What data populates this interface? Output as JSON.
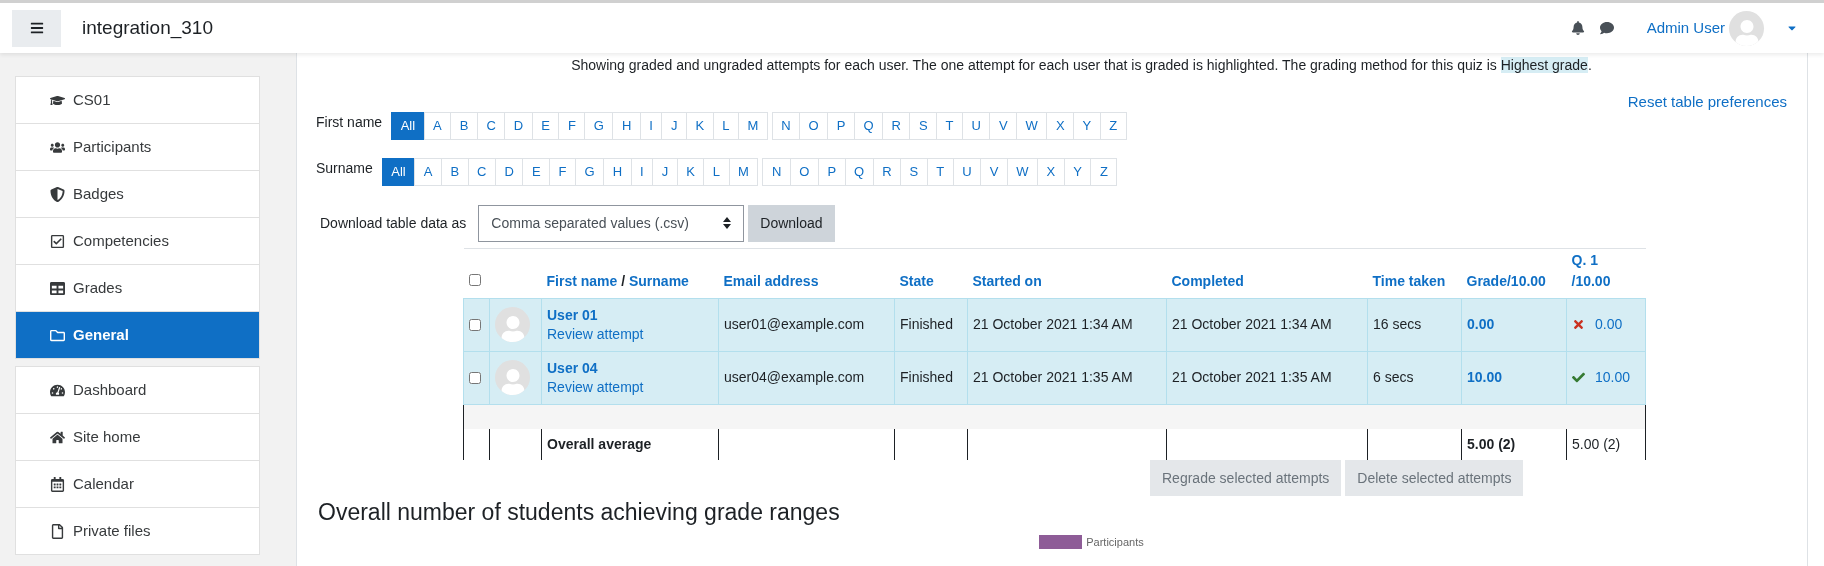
{
  "navbar": {
    "site_name": "integration_310",
    "user_name": "Admin User"
  },
  "sidebar": {
    "course_items": [
      {
        "label": "CS01",
        "selected": false
      },
      {
        "label": "Participants",
        "selected": false
      },
      {
        "label": "Badges",
        "selected": false
      },
      {
        "label": "Competencies",
        "selected": false
      },
      {
        "label": "Grades",
        "selected": false
      },
      {
        "label": "General",
        "selected": true
      }
    ],
    "site_items": [
      {
        "label": "Dashboard",
        "selected": false
      },
      {
        "label": "Site home",
        "selected": false
      },
      {
        "label": "Calendar",
        "selected": false
      },
      {
        "label": "Private files",
        "selected": false
      }
    ]
  },
  "intro": {
    "before": "Showing graded and ungraded attempts for each user. The one attempt for each user that is graded is highlighted. The grading method for this quiz is",
    "highlight": "Highest grade",
    "after": "."
  },
  "reset_link": "Reset table preferences",
  "filters": [
    {
      "label": "First name",
      "letters": [
        {
          "label": "All",
          "selected": true
        },
        {
          "label": "A",
          "selected": false
        },
        {
          "label": "B",
          "selected": false
        },
        {
          "label": "C",
          "selected": false
        },
        {
          "label": "D",
          "selected": false
        },
        {
          "label": "E",
          "selected": false
        },
        {
          "label": "F",
          "selected": false
        },
        {
          "label": "G",
          "selected": false
        },
        {
          "label": "H",
          "selected": false
        },
        {
          "label": "I",
          "selected": false
        },
        {
          "label": "J",
          "selected": false
        },
        {
          "label": "K",
          "selected": false
        },
        {
          "label": "L",
          "selected": false
        },
        {
          "label": "M",
          "selected": false
        },
        {
          "label": "N",
          "selected": false
        },
        {
          "label": "O",
          "selected": false
        },
        {
          "label": "P",
          "selected": false
        },
        {
          "label": "Q",
          "selected": false
        },
        {
          "label": "R",
          "selected": false
        },
        {
          "label": "S",
          "selected": false
        },
        {
          "label": "T",
          "selected": false
        },
        {
          "label": "U",
          "selected": false
        },
        {
          "label": "V",
          "selected": false
        },
        {
          "label": "W",
          "selected": false
        },
        {
          "label": "X",
          "selected": false
        },
        {
          "label": "Y",
          "selected": false
        },
        {
          "label": "Z",
          "selected": false
        }
      ]
    },
    {
      "label": "Surname",
      "letters": [
        {
          "label": "All",
          "selected": true
        },
        {
          "label": "A",
          "selected": false
        },
        {
          "label": "B",
          "selected": false
        },
        {
          "label": "C",
          "selected": false
        },
        {
          "label": "D",
          "selected": false
        },
        {
          "label": "E",
          "selected": false
        },
        {
          "label": "F",
          "selected": false
        },
        {
          "label": "G",
          "selected": false
        },
        {
          "label": "H",
          "selected": false
        },
        {
          "label": "I",
          "selected": false
        },
        {
          "label": "J",
          "selected": false
        },
        {
          "label": "K",
          "selected": false
        },
        {
          "label": "L",
          "selected": false
        },
        {
          "label": "M",
          "selected": false
        },
        {
          "label": "N",
          "selected": false
        },
        {
          "label": "O",
          "selected": false
        },
        {
          "label": "P",
          "selected": false
        },
        {
          "label": "Q",
          "selected": false
        },
        {
          "label": "R",
          "selected": false
        },
        {
          "label": "S",
          "selected": false
        },
        {
          "label": "T",
          "selected": false
        },
        {
          "label": "U",
          "selected": false
        },
        {
          "label": "V",
          "selected": false
        },
        {
          "label": "W",
          "selected": false
        },
        {
          "label": "X",
          "selected": false
        },
        {
          "label": "Y",
          "selected": false
        },
        {
          "label": "Z",
          "selected": false
        }
      ]
    }
  ],
  "download": {
    "label": "Download table data as",
    "format": "Comma separated values (.csv)",
    "button": "Download"
  },
  "table": {
    "select_all_checked": false,
    "columns": {
      "first_name": "First name",
      "separator": "/",
      "surname": "Surname",
      "email": "Email address",
      "state": "State",
      "started": "Started on",
      "completed": "Completed",
      "time_taken": "Time taken",
      "grade": "Grade/10.00",
      "question": "Q. 1 /10.00"
    },
    "rows": [
      {
        "checked": false,
        "highlighted": true,
        "name": "User 01",
        "review": "Review attempt",
        "email": "user01@example.com",
        "state": "Finished",
        "started": "21 October 2021 1:34 AM",
        "completed": "21 October 2021 1:34 AM",
        "time_taken": "16 secs",
        "grade": "0.00",
        "question_correct": false,
        "question_grade": "0.00"
      },
      {
        "checked": false,
        "highlighted": true,
        "name": "User 04",
        "review": "Review attempt",
        "email": "user04@example.com",
        "state": "Finished",
        "started": "21 October 2021 1:35 AM",
        "completed": "21 October 2021 1:35 AM",
        "time_taken": "6 secs",
        "grade": "10.00",
        "question_correct": true,
        "question_grade": "10.00"
      }
    ],
    "average": {
      "label": "Overall average",
      "grade": "5.00 (2)",
      "question_grade": "5.00 (2)"
    }
  },
  "actions": [
    {
      "label": "Regrade selected attempts",
      "disabled": true
    },
    {
      "label": "Delete selected attempts",
      "disabled": true
    }
  ],
  "chart_heading": "Overall number of students achieving grade ranges",
  "chart_legend": [
    {
      "label": "Participants",
      "color": "#8e5c97"
    }
  ]
}
